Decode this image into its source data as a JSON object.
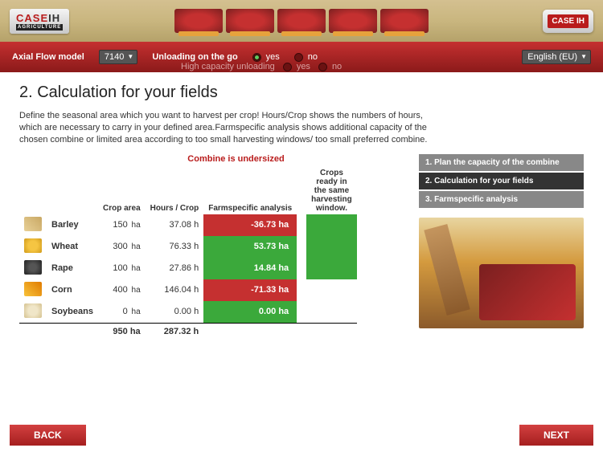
{
  "brand": {
    "name": "CASE",
    "suffix": "IH",
    "subline": "AGRICULTURE"
  },
  "topbar": {
    "model_label": "Axial Flow model",
    "model_value": "7140",
    "unloading_label": "Unloading on the go",
    "unloading_yes": "yes",
    "unloading_no": "no",
    "high_cap_label": "High capacity unloading",
    "high_cap_yes": "yes",
    "high_cap_no": "no",
    "language": "English (EU)"
  },
  "page": {
    "title": "2. Calculation for your fields",
    "intro": "Define the seasonal area which you want to harvest per crop! Hours/Crop shows the numbers of hours, which are necessary to carry in your defined area.Farmspecific analysis shows additional capacity of the chosen combine or limited area according to too small harvesting windows/ too small preferred combine.",
    "warning": "Combine is undersized"
  },
  "table": {
    "h_crop_area": "Crop area",
    "h_hours": "Hours / Crop",
    "h_analysis": "Farmspecific analysis",
    "h_window": "Crops ready in the same harvesting window.",
    "unit_area": "ha",
    "unit_hours": "h",
    "rows": [
      {
        "name": "Barley",
        "icon": "ic-barley",
        "area": "150",
        "hours": "37.08",
        "analysis": "-36.73 ha",
        "cls": "neg",
        "window": true
      },
      {
        "name": "Wheat",
        "icon": "ic-wheat",
        "area": "300",
        "hours": "76.33",
        "analysis": "53.73 ha",
        "cls": "pos",
        "window": true
      },
      {
        "name": "Rape",
        "icon": "ic-rape",
        "area": "100",
        "hours": "27.86",
        "analysis": "14.84 ha",
        "cls": "pos",
        "window": true
      },
      {
        "name": "Corn",
        "icon": "ic-corn",
        "area": "400",
        "hours": "146.04",
        "analysis": "-71.33 ha",
        "cls": "neg",
        "window": false
      },
      {
        "name": "Soybeans",
        "icon": "ic-soy",
        "area": "0",
        "hours": "0.00",
        "analysis": "0.00 ha",
        "cls": "zero",
        "window": false
      }
    ],
    "total_area": "950 ha",
    "total_hours": "287.32 h"
  },
  "sidebar": {
    "items": [
      {
        "label": "1. Plan the capacity of the combine",
        "active": false
      },
      {
        "label": "2. Calculation for your fields",
        "active": true
      },
      {
        "label": "3. Farmspecific analysis",
        "active": false
      }
    ]
  },
  "footer": {
    "back": "BACK",
    "next": "NEXT"
  }
}
